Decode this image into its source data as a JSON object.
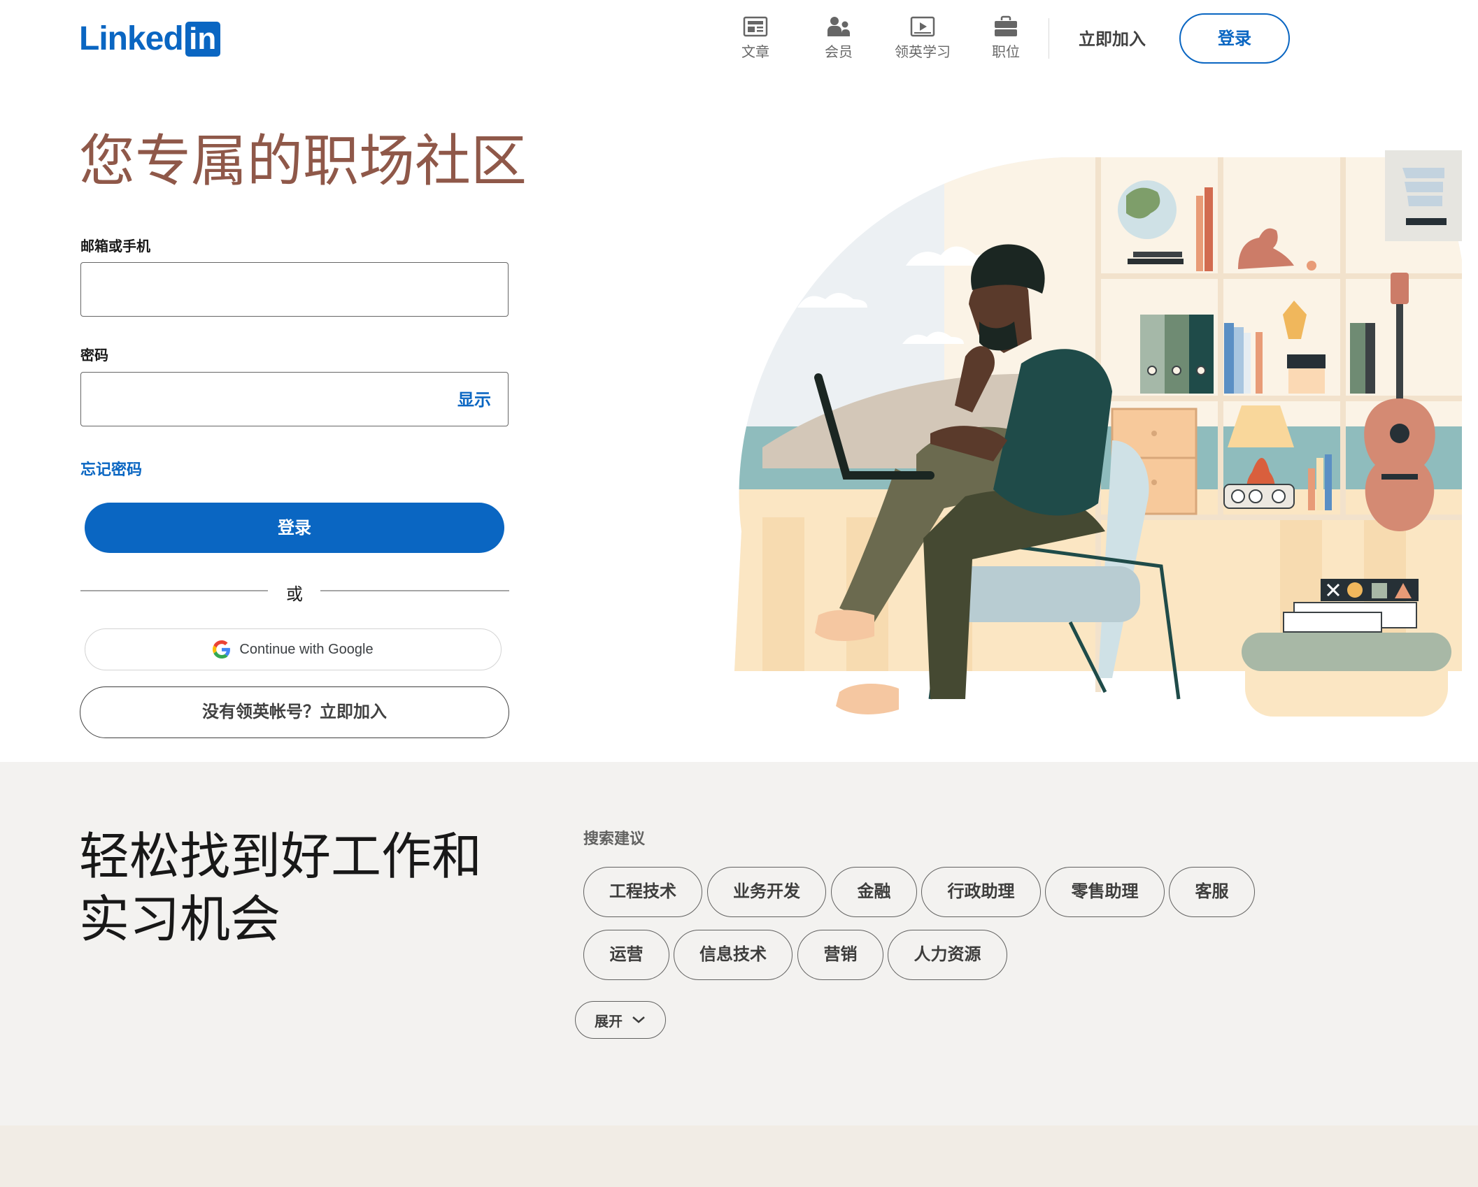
{
  "brand": {
    "logo_word": "Linked",
    "logo_box": "in",
    "accent": "#0a66c2",
    "headline_color": "#8f5849"
  },
  "nav": {
    "items": [
      {
        "label": "文章",
        "icon": "article-icon"
      },
      {
        "label": "会员",
        "icon": "people-icon"
      },
      {
        "label": "领英学习",
        "icon": "learning-icon"
      },
      {
        "label": "职位",
        "icon": "briefcase-icon"
      }
    ],
    "join": "立即加入",
    "sign_in": "登录"
  },
  "hero": {
    "title": "您专属的职场社区",
    "email_label": "邮箱或手机",
    "email_value": "",
    "password_label": "密码",
    "password_value": "",
    "show_password": "显示",
    "forgot_password": "忘记密码",
    "sign_in_button": "登录",
    "divider_text": "或",
    "google_button": "Continue with Google",
    "join_button": "没有领英帐号？立即加入"
  },
  "jobs": {
    "title": "轻松找到好工作和实习机会",
    "suggestions_label": "搜索建议",
    "chips": [
      "工程技术",
      "业务开发",
      "金融",
      "行政助理",
      "零售助理",
      "客服",
      "运营",
      "信息技术",
      "营销",
      "人力资源"
    ],
    "expand": "展开"
  }
}
